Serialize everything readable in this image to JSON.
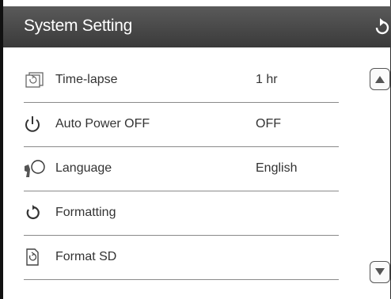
{
  "header": {
    "title": "System Setting",
    "back_icon": "return-arrow-icon"
  },
  "settings": [
    {
      "label": "Time-lapse",
      "value": "1 hr",
      "icon": "time-lapse-icon"
    },
    {
      "label": "Auto Power OFF",
      "value": "OFF",
      "icon": "power-icon"
    },
    {
      "label": "Language",
      "value": "English",
      "icon": "speaking-head-icon"
    },
    {
      "label": "Formatting",
      "value": "",
      "icon": "circular-arrow-icon"
    },
    {
      "label": "Format SD",
      "value": "",
      "icon": "format-sd-icon"
    }
  ],
  "scroll": {
    "up_icon": "triangle-up-icon",
    "down_icon": "triangle-down-icon"
  },
  "colors": {
    "header_bg": "#4a4a4a",
    "header_text": "#ffffff",
    "text": "#333333",
    "divider": "#8a8a8a"
  }
}
